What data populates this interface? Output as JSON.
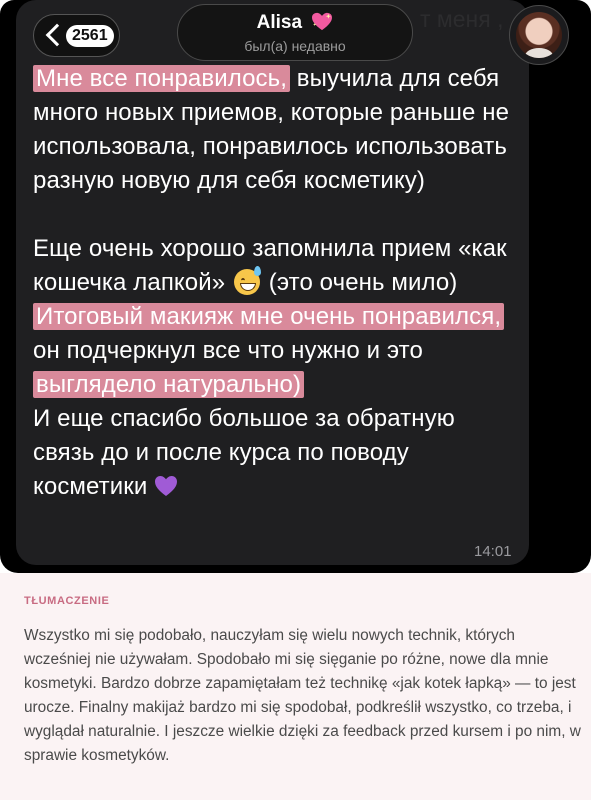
{
  "header": {
    "back_count": "2561",
    "contact_name": "Alisa",
    "contact_emoji": "sparkling-heart-icon",
    "status": "был(а) недавно",
    "background_snippet": "т меня ,"
  },
  "message": {
    "seg1_hl": "Мне все понравилось,",
    "seg1": " выучила для себя много новых приемов, которые раньше не использовала, понравилось использовать разную новую для себя косметику)",
    "seg2a": "Еще очень хорошо запомнила прием «как кошечка лапкой»",
    "seg2b": " (это очень мило)",
    "seg3_hl1": "Итоговый макияж мне очень понравился,",
    "seg3a": " он подчеркнул все что нужно и это ",
    "seg3_hl2": "выглядело натурально)",
    "seg4": "И еще спасибо большое за обратную связь до и после курса по поводу косметики",
    "emoji_sweat": "grinning-sweat-icon",
    "emoji_heart": "purple-heart-icon",
    "time": "14:01"
  },
  "translation": {
    "label": "TŁUMACZENIE",
    "text": "Wszystko mi się podobało, nauczyłam się wielu nowych technik, których wcześniej nie używałam. Spodobało mi się sięganie po różne, nowe dla mnie kosmetyki. Bardzo dobrze zapamiętałam też technikę «jak kotek łapką» — to jest urocze. Finalny makijaż bardzo mi się spodobał, podkreślił wszystko, co trzeba, i wyglądał naturalnie. I jeszcze wielkie dzięki za feedback przed kursem i po nim, w sprawie kosmetyków."
  },
  "colors": {
    "highlight": "#d98a9b",
    "bubble": "#1f1f21",
    "translation_bg": "#fbf3f4",
    "label": "#c86b82"
  }
}
